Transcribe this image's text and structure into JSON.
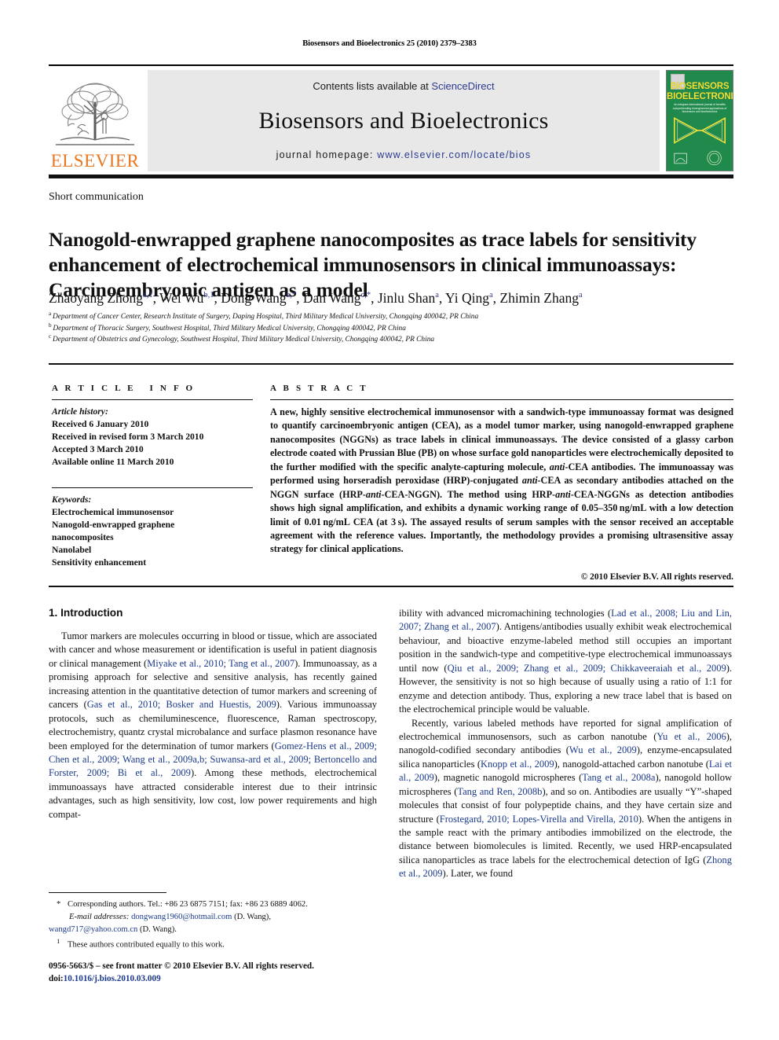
{
  "running_head": "Biosensors and Bioelectronics 25 (2010) 2379–2383",
  "masthead": {
    "publisher_name": "ELSEVIER",
    "contents_prefix": "Contents lists available at ",
    "sciencedirect": "ScienceDirect",
    "journal_title": "Biosensors and Bioelectronics",
    "homepage_prefix": "journal homepage: ",
    "homepage_url": "www.elsevier.com/locate/bios",
    "cover": {
      "line1": "BIOSENSORS",
      "line2": "BIOELECTRONICS",
      "tagline": "An integrare international journal of benefits comprehending bioengineered applications of biosensors and bioelectronics",
      "bg_color": "#1f8a4c",
      "text_color": "#f2e23a"
    }
  },
  "article": {
    "doctype": "Short communication",
    "title": "Nanogold-enwrapped graphene nanocomposites as trace labels for sensitivity enhancement of electrochemical immunosensors in clinical immunoassays: Carcinoembryonic antigen as a model",
    "authors": [
      {
        "name": "Zhaoyang Zhong",
        "marks": "a,1"
      },
      {
        "name": "Wei Wu",
        "marks": "b,1"
      },
      {
        "name": "Dong Wang",
        "marks": "a,*"
      },
      {
        "name": "Dan Wang",
        "marks": "c,*"
      },
      {
        "name": "Jinlu Shan",
        "marks": "a"
      },
      {
        "name": "Yi Qing",
        "marks": "a"
      },
      {
        "name": "Zhimin Zhang",
        "marks": "a"
      }
    ],
    "affiliations": [
      {
        "mark": "a",
        "text": "Department of Cancer Center, Research Institute of Surgery, Daping Hospital, Third Military Medical University, Chongqing 400042, PR China"
      },
      {
        "mark": "b",
        "text": "Department of Thoracic Surgery, Southwest Hospital, Third Military Medical University, Chongqing 400042, PR China"
      },
      {
        "mark": "c",
        "text": "Department of Obstetrics and Gynecology, Southwest Hospital, Third Military Medical University, Chongqing 400042, PR China"
      }
    ]
  },
  "article_info": {
    "heading": "ARTICLE INFO",
    "history_label": "Article history:",
    "history": [
      "Received 6 January 2010",
      "Received in revised form 3 March 2010",
      "Accepted 3 March 2010",
      "Available online 11 March 2010"
    ],
    "keywords_label": "Keywords:",
    "keywords": [
      "Electrochemical immunosensor",
      "Nanogold-enwrapped graphene",
      "nanocomposites",
      "Nanolabel",
      "Sensitivity enhancement"
    ]
  },
  "abstract": {
    "heading": "ABSTRACT",
    "copyright": "© 2010 Elsevier B.V. All rights reserved."
  },
  "introduction": {
    "heading": "1.  Introduction"
  },
  "footnotes": {
    "corresponding": "Corresponding authors. Tel.: +86 23 6875 7151; fax: +86 23 6889 4062.",
    "email_label": "E-mail addresses:",
    "email1": "dongwang1960@hotmail.com",
    "email1_owner": "(D. Wang),",
    "email2": "wangd717@yahoo.com.cn",
    "email2_owner": "(D. Wang).",
    "equal_contrib": "These authors contributed equally to this work.",
    "asterisk": "*",
    "one": "1"
  },
  "issn": {
    "line1": "0956-5663/$ – see front matter © 2010 Elsevier B.V. All rights reserved.",
    "doi_label": "doi:",
    "doi": "10.1016/j.bios.2010.03.009"
  },
  "colors": {
    "reference_link": "#1b3a8c",
    "elsevier_orange": "#E87722",
    "band_gray": "#e8e8e9"
  }
}
